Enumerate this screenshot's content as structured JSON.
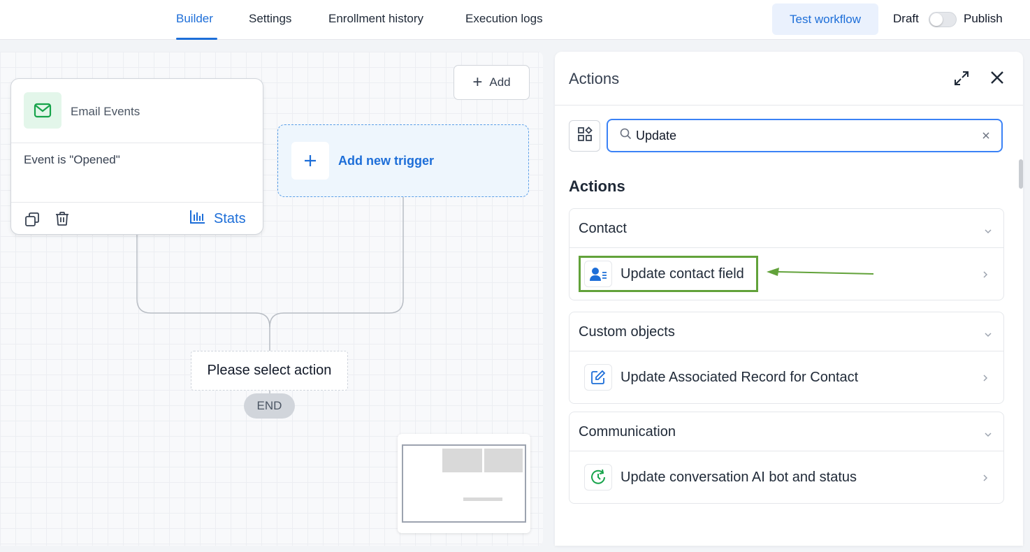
{
  "tabs": [
    {
      "label": "Builder",
      "active": true
    },
    {
      "label": "Settings",
      "active": false
    },
    {
      "label": "Enrollment history",
      "active": false
    },
    {
      "label": "Execution logs",
      "active": false
    }
  ],
  "header": {
    "test_label": "Test workflow",
    "draft_label": "Draft",
    "publish_label": "Publish",
    "published": false
  },
  "canvas": {
    "add_label": "Add",
    "trigger": {
      "title": "Email Events",
      "condition": "Event is \"Opened\"",
      "stats_label": "Stats"
    },
    "new_trigger_label": "Add new trigger",
    "select_action_label": "Please select action",
    "end_label": "END"
  },
  "panel": {
    "title": "Actions",
    "search": {
      "value": "Update"
    },
    "section_heading": "Actions",
    "groups": [
      {
        "title": "Contact",
        "items": [
          {
            "label": "Update contact field",
            "icon": "contact-field-icon",
            "highlighted": true
          }
        ]
      },
      {
        "title": "Custom objects",
        "items": [
          {
            "label": "Update Associated Record for Contact",
            "icon": "edit-record-icon"
          }
        ]
      },
      {
        "title": "Communication",
        "items": [
          {
            "label": "Update conversation AI bot and status",
            "icon": "bot-status-icon"
          }
        ]
      }
    ]
  },
  "colors": {
    "accent": "#1d6ed8",
    "highlight": "#62a23a",
    "trigger_icon_bg": "#e3f6ea",
    "trigger_icon": "#16a34a"
  }
}
